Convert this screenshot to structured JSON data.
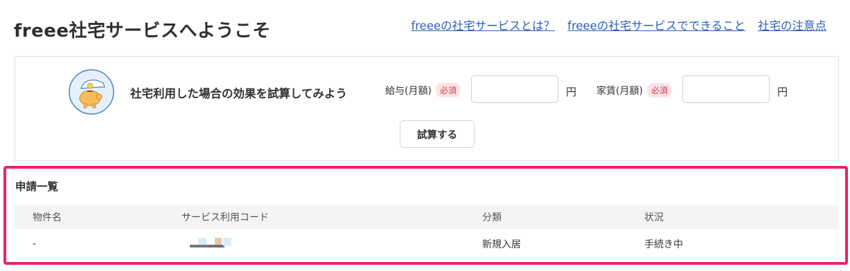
{
  "header": {
    "title": "freee社宅サービスへようこそ",
    "links": [
      "freeeの社宅サービスとは？",
      "freeeの社宅サービスでできること",
      "社宅の注意点"
    ]
  },
  "simulator": {
    "heading": "社宅利用した場合の効果を試算してみよう",
    "salary_label": "給与(月額)",
    "rent_label": "家賃(月額)",
    "required_badge": "必須",
    "unit": "円",
    "salary_value": "",
    "rent_value": "",
    "calc_button": "試算する",
    "icon": "piggy-bank-icon"
  },
  "applications": {
    "title": "申請一覧",
    "columns": [
      "物件名",
      "サービス利用コード",
      "分類",
      "状況"
    ],
    "rows": [
      {
        "property": "-",
        "code": "",
        "category": "新規入居",
        "status": "手続き中"
      }
    ]
  },
  "colors": {
    "link": "#2a5fb8",
    "highlight": "#ee1f6a",
    "badge_bg": "#fbe3e6",
    "badge_text": "#d43a4e"
  }
}
